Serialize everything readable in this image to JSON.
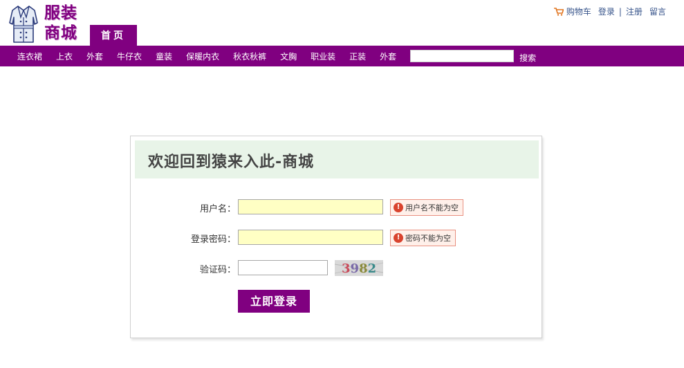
{
  "brand": {
    "logo_line1": "服装",
    "logo_line2": "商城",
    "home_tab": "首页",
    "accent_color": "#800080"
  },
  "top_links": {
    "cart": "购物车",
    "login": "登录",
    "register": "注册",
    "message": "留言"
  },
  "nav": {
    "items": [
      "连衣裙",
      "上衣",
      "外套",
      "牛仔衣",
      "童装",
      "保暖内衣",
      "秋衣秋裤",
      "文胸",
      "职业装",
      "正装",
      "外套"
    ],
    "search_value": "",
    "search_button": "搜索"
  },
  "login": {
    "title": "欢迎回到猿来入此-商城",
    "username_label": "用户名：",
    "username_value": "",
    "username_error": "用户名不能为空",
    "password_label": "登录密码：",
    "password_value": "",
    "password_error": "密码不能为空",
    "captcha_label": "验证码：",
    "captcha_value": "",
    "captcha_text": "3982",
    "submit": "立即登录"
  }
}
